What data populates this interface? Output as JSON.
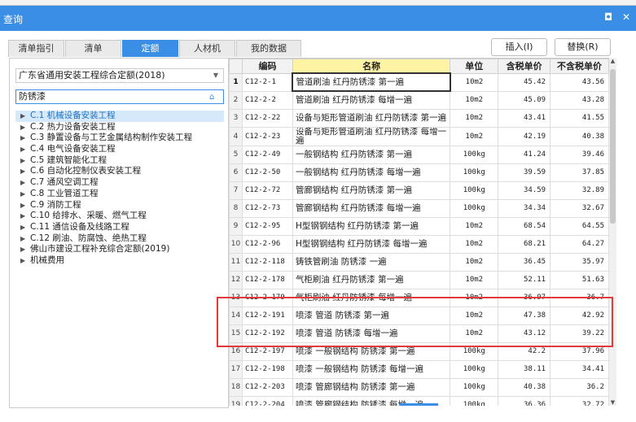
{
  "window": {
    "title": "查询",
    "restore_glyph": "◘",
    "close_glyph": "✕"
  },
  "tabs": [
    "清单指引",
    "清单",
    "定额",
    "人材机",
    "我的数据"
  ],
  "buttons": {
    "insert": "插入(I)",
    "replace": "替换(R)"
  },
  "left": {
    "combo_value": "广东省通用安装工程综合定额(2018)",
    "search_value": "防锈漆",
    "tree": [
      "C.1 机械设备安装工程",
      "C.2 热力设备安装工程",
      "C.3 静置设备与工艺金属结构制作安装工程",
      "C.4 电气设备安装工程",
      "C.5 建筑智能化工程",
      "C.6 自动化控制仪表安装工程",
      "C.7 通风空调工程",
      "C.8 工业管道工程",
      "C.9 消防工程",
      "C.10 给排水、采暖、燃气工程",
      "C.11 通信设备及线路工程",
      "C.12 刷油、防腐蚀、绝热工程",
      "佛山市建设工程补充综合定额(2019)",
      "机械费用"
    ]
  },
  "table": {
    "headers": [
      "编码",
      "名称",
      "单位",
      "含税单价",
      "不含税单价"
    ],
    "rows": [
      {
        "idx": "1",
        "code": "C12-2-1",
        "name": "管道刷油 红丹防锈漆 第一遍",
        "unit": "10m2",
        "tax": "45.42",
        "notax": "43.56"
      },
      {
        "idx": "2",
        "code": "C12-2-2",
        "name": "管道刷油 红丹防锈漆 每增一遍",
        "unit": "10m2",
        "tax": "45.09",
        "notax": "43.28"
      },
      {
        "idx": "3",
        "code": "C12-2-22",
        "name": "设备与矩形管道刷油 红丹防锈漆 第一遍",
        "unit": "10m2",
        "tax": "43.41",
        "notax": "41.55"
      },
      {
        "idx": "4",
        "code": "C12-2-23",
        "name": "设备与矩形管道刷油 红丹防锈漆 每增一遍",
        "unit": "10m2",
        "tax": "42.19",
        "notax": "40.38"
      },
      {
        "idx": "5",
        "code": "C12-2-49",
        "name": "一般钢结构 红丹防锈漆 第一遍",
        "unit": "100kg",
        "tax": "41.24",
        "notax": "39.46"
      },
      {
        "idx": "6",
        "code": "C12-2-50",
        "name": "一般钢结构 红丹防锈漆 每增一遍",
        "unit": "100kg",
        "tax": "39.59",
        "notax": "37.85"
      },
      {
        "idx": "7",
        "code": "C12-2-72",
        "name": "管廊钢结构 红丹防锈漆 第一遍",
        "unit": "100kg",
        "tax": "34.59",
        "notax": "32.89"
      },
      {
        "idx": "8",
        "code": "C12-2-73",
        "name": "管廊钢结构 红丹防锈漆 每增一遍",
        "unit": "100kg",
        "tax": "34.34",
        "notax": "32.67"
      },
      {
        "idx": "9",
        "code": "C12-2-95",
        "name": "H型钢钢结构 红丹防锈漆 第一遍",
        "unit": "10m2",
        "tax": "68.54",
        "notax": "64.55"
      },
      {
        "idx": "10",
        "code": "C12-2-96",
        "name": "H型钢钢结构 红丹防锈漆 每增一遍",
        "unit": "10m2",
        "tax": "68.21",
        "notax": "64.27"
      },
      {
        "idx": "11",
        "code": "C12-2-118",
        "name": "铸铁管刷油 防锈漆 一遍",
        "unit": "10m2",
        "tax": "36.45",
        "notax": "35.97"
      },
      {
        "idx": "12",
        "code": "C12-2-178",
        "name": "气柜刷油 红丹防锈漆 第一遍",
        "unit": "10m2",
        "tax": "52.11",
        "notax": "51.63"
      },
      {
        "idx": "13",
        "code": "C12-2-179",
        "name": "气柜刷油 红丹防锈漆 每增一遍",
        "unit": "10m2",
        "tax": "36.97",
        "notax": "36.7"
      },
      {
        "idx": "14",
        "code": "C12-2-191",
        "name": "喷漆 管道 防锈漆 第一遍",
        "unit": "10m2",
        "tax": "47.38",
        "notax": "42.92"
      },
      {
        "idx": "15",
        "code": "C12-2-192",
        "name": "喷漆 管道 防锈漆 每增一遍",
        "unit": "10m2",
        "tax": "43.12",
        "notax": "39.22"
      },
      {
        "idx": "16",
        "code": "C12-2-197",
        "name": "喷漆 一般钢结构 防锈漆 第一遍",
        "unit": "100kg",
        "tax": "42.2",
        "notax": "37.96"
      },
      {
        "idx": "17",
        "code": "C12-2-198",
        "name": "喷漆 一般钢结构 防锈漆 每增一遍",
        "unit": "100kg",
        "tax": "38.11",
        "notax": "34.41"
      },
      {
        "idx": "18",
        "code": "C12-2-203",
        "name": "喷漆 管廊钢结构 防锈漆 第一遍",
        "unit": "100kg",
        "tax": "40.38",
        "notax": "36.2"
      },
      {
        "idx": "19",
        "code": "C12-2-204",
        "name": "喷漆 管廊钢结构 防锈漆 每增一遍",
        "unit": "100kg",
        "tax": "36.36",
        "notax": "32.72"
      }
    ]
  },
  "colors": {
    "accent": "#3a8ee6",
    "highlight_box": "#e03a3a",
    "name_header": "#fff4a3"
  }
}
